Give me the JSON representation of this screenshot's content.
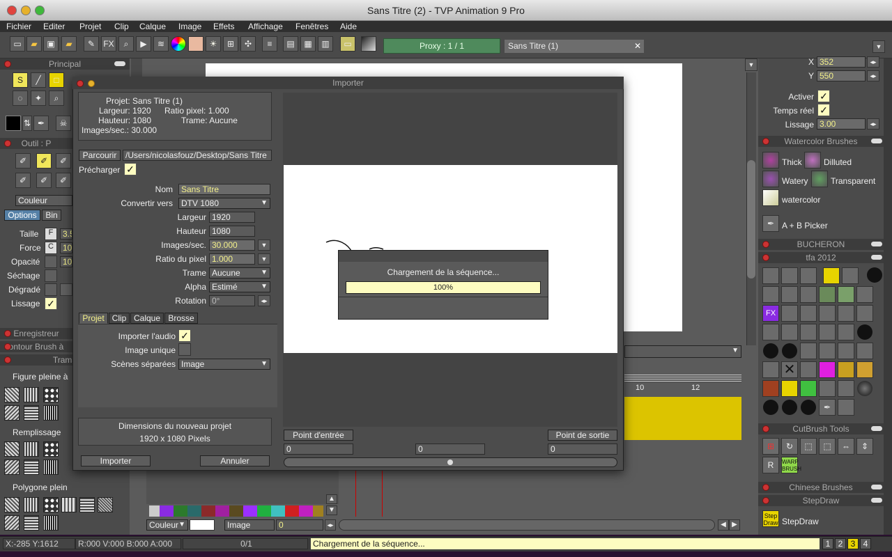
{
  "window": {
    "title": "Sans Titre (2) - TVP Animation 9 Pro"
  },
  "menu": [
    "Fichier",
    "Editer",
    "Projet",
    "Clip",
    "Calque",
    "Image",
    "Effets",
    "Affichage",
    "Fenêtres",
    "Aide"
  ],
  "toolbar": {
    "proxy_label": "Proxy : 1 / 1",
    "doc_tab": "Sans Titre (1)",
    "fx_label": "FX",
    "close": "✕"
  },
  "left_panels": {
    "principal": "Principal",
    "outil": "Outil : P",
    "couleur": "Couleur",
    "tabs": [
      "Options",
      "Bin"
    ],
    "options": [
      {
        "label": "Taille",
        "value": "3.5"
      },
      {
        "label": "Force",
        "value": "10"
      },
      {
        "label": "Opacité",
        "value": "10"
      },
      {
        "label": "Séchage",
        "value": ""
      },
      {
        "label": "Dégradé",
        "value": ""
      },
      {
        "label": "Lissage",
        "value": ""
      }
    ],
    "enregistreur": "Enregistreur",
    "contour": "ontour Brush à",
    "trama": "Trama",
    "figure": "Figure pleine à",
    "remplissage": "Remplissage",
    "polygone": "Polygone plein"
  },
  "importer": {
    "title": "Importer",
    "info": {
      "projet": "Projet: Sans Titre (1)",
      "largeur": "Largeur: 1920",
      "ratio": "Ratio pixel: 1.000",
      "hauteur": "Hauteur: 1080",
      "trame": "Trame: Aucune",
      "images": "Images/sec.: 30.000"
    },
    "parcourir": "Parcourir",
    "path": "/Users/nicolasfouz/Desktop/Sans Titre",
    "precharger": "Précharger",
    "rows": [
      {
        "label": "Nom",
        "value": "Sans Titre"
      },
      {
        "label": "Convertir vers",
        "value": "DTV 1080"
      },
      {
        "label": "Largeur",
        "value": "1920"
      },
      {
        "label": "Hauteur",
        "value": "1080"
      },
      {
        "label": "Images/sec.",
        "value": "30.000"
      },
      {
        "label": "Ratio du pixel",
        "value": "1.000"
      },
      {
        "label": "Trame",
        "value": "Aucune"
      },
      {
        "label": "Alpha",
        "value": "Estimé"
      },
      {
        "label": "Rotation",
        "value": "0°"
      }
    ],
    "tabs": [
      "Projet",
      "Clip",
      "Calque",
      "Brosse"
    ],
    "importer_audio": "Importer l'audio",
    "image_unique": "Image unique",
    "scenes": "Scènes séparées",
    "scenes_value": "Image",
    "dims_title": "Dimensions du nouveau projet",
    "dims_value": "1920 x 1080 Pixels",
    "btn_import": "Importer",
    "btn_cancel": "Annuler",
    "point_entree": "Point d'entrée",
    "point_sortie": "Point de sortie",
    "in_value": "0",
    "mid_value": "0",
    "out_value": "0"
  },
  "progress": {
    "text": "Chargement de la séquence...",
    "label": "100%",
    "fraction": 1.0
  },
  "right": {
    "x_label": "X",
    "x_value": "352",
    "y_label": "Y",
    "y_value": "550",
    "activer": "Activer",
    "temps_reel": "Temps réel",
    "lissage": "Lissage",
    "lissage_value": "3.00",
    "watercolor_title": "Watercolor Brushes",
    "watercolor": [
      "Thick",
      "Dilluted",
      "Watery",
      "Transparent",
      "watercolor",
      "A + B Picker"
    ],
    "bucheron": "BUCHERON",
    "tfa": "tfa 2012",
    "cutbrush": "CutBrush Tools",
    "chinese": "Chinese Brushes",
    "stepdraw": "StepDraw",
    "stepdraw_icon": "Step Draw",
    "warp_icon": "WARP BRUSH"
  },
  "timeline": {
    "tick_10": "10",
    "tick_12": "12",
    "couleur": "Couleur",
    "image": "Image",
    "frame": "0"
  },
  "status": {
    "coords": "X:-285  Y:1612",
    "rgba": "R:000 V:000 B:000 A:000",
    "frame": "0/1",
    "message": "Chargement de la séquence...",
    "pages": [
      "1",
      "2",
      "3",
      "4"
    ]
  }
}
